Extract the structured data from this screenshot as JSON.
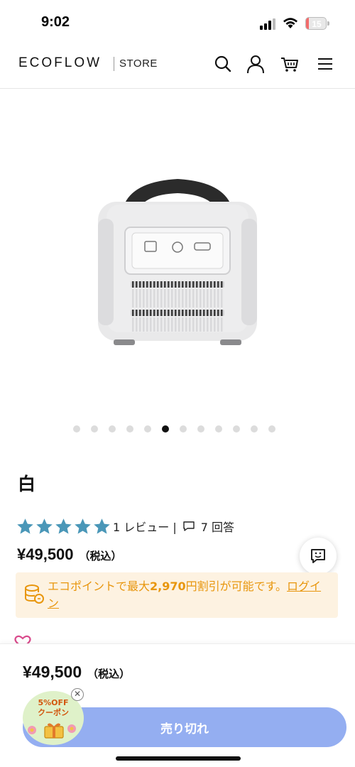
{
  "status_bar": {
    "time": "9:02",
    "battery": "15",
    "battery_level": 0.15
  },
  "header": {
    "logo": "ECOFLOW",
    "store": "STORE"
  },
  "carousel": {
    "total": 12,
    "active_index": 5
  },
  "product": {
    "variant": "白",
    "rating": 5,
    "review_text": "1 レビュー |",
    "qa_text": "7 回答",
    "price": "¥49,500",
    "tax_label": "（税込）"
  },
  "points_banner": {
    "text_before": "エコポイントで最大",
    "highlight": "2,970",
    "text_after": "円割引が可能です。",
    "link": "ログイン",
    "color": "#e8960d",
    "bg": "#fdf2e1"
  },
  "bottom_bar": {
    "price": "¥49,500",
    "tax_label": "（税込）",
    "button": "売り切れ",
    "button_color": "#94aef1"
  },
  "coupon": {
    "line1": "5%OFF",
    "line2": "クーポン"
  },
  "colors": {
    "star": "#4a97b8"
  }
}
